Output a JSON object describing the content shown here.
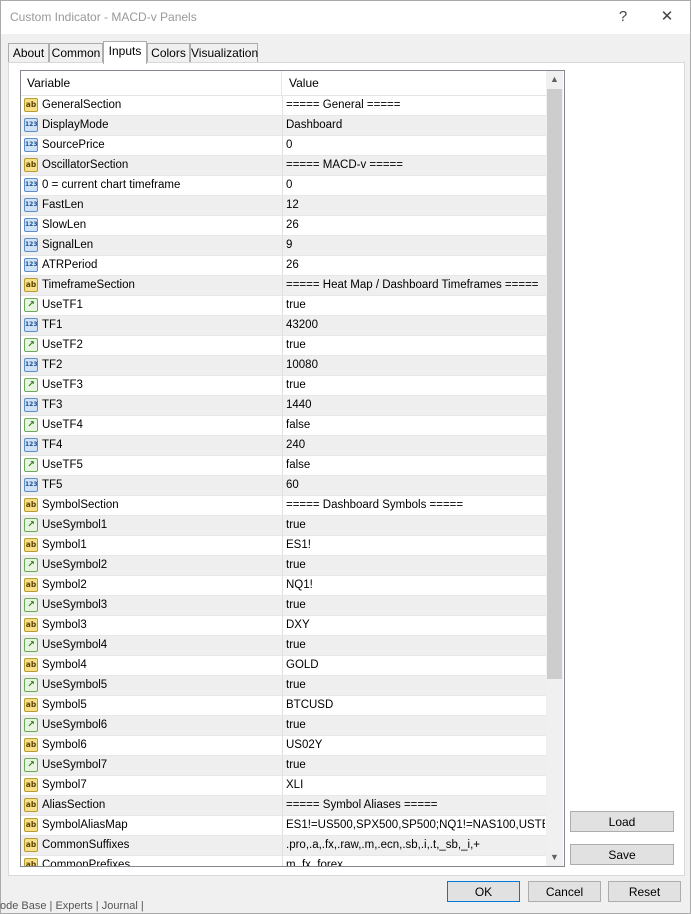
{
  "window": {
    "title": "Custom Indicator - MACD-v Panels",
    "help_glyph": "?",
    "close_glyph": "✕"
  },
  "tabs": [
    {
      "label": "About",
      "active": false
    },
    {
      "label": "Common",
      "active": false
    },
    {
      "label": "Inputs",
      "active": true
    },
    {
      "label": "Colors",
      "active": false
    },
    {
      "label": "Visualization",
      "active": false
    }
  ],
  "table": {
    "headers": {
      "variable": "Variable",
      "value": "Value"
    },
    "rows": [
      {
        "icon": "ab",
        "variable": "GeneralSection",
        "value": "===== General ====="
      },
      {
        "icon": "123",
        "variable": "DisplayMode",
        "value": "Dashboard"
      },
      {
        "icon": "123",
        "variable": "SourcePrice",
        "value": "0"
      },
      {
        "icon": "ab",
        "variable": "OscillatorSection",
        "value": "===== MACD-v ====="
      },
      {
        "icon": "123",
        "variable": "0 = current chart timeframe",
        "value": "0"
      },
      {
        "icon": "123",
        "variable": "FastLen",
        "value": "12"
      },
      {
        "icon": "123",
        "variable": "SlowLen",
        "value": "26"
      },
      {
        "icon": "123",
        "variable": "SignalLen",
        "value": "9"
      },
      {
        "icon": "123",
        "variable": "ATRPeriod",
        "value": "26"
      },
      {
        "icon": "ab",
        "variable": "TimeframeSection",
        "value": "===== Heat Map / Dashboard Timeframes ====="
      },
      {
        "icon": "bool",
        "variable": "UseTF1",
        "value": "true"
      },
      {
        "icon": "123",
        "variable": "TF1",
        "value": "43200"
      },
      {
        "icon": "bool",
        "variable": "UseTF2",
        "value": "true"
      },
      {
        "icon": "123",
        "variable": "TF2",
        "value": "10080"
      },
      {
        "icon": "bool",
        "variable": "UseTF3",
        "value": "true"
      },
      {
        "icon": "123",
        "variable": "TF3",
        "value": "1440"
      },
      {
        "icon": "bool",
        "variable": "UseTF4",
        "value": "false"
      },
      {
        "icon": "123",
        "variable": "TF4",
        "value": "240"
      },
      {
        "icon": "bool",
        "variable": "UseTF5",
        "value": "false"
      },
      {
        "icon": "123",
        "variable": "TF5",
        "value": "60"
      },
      {
        "icon": "ab",
        "variable": "SymbolSection",
        "value": "===== Dashboard Symbols ====="
      },
      {
        "icon": "bool",
        "variable": "UseSymbol1",
        "value": "true"
      },
      {
        "icon": "ab",
        "variable": "Symbol1",
        "value": "ES1!"
      },
      {
        "icon": "bool",
        "variable": "UseSymbol2",
        "value": "true"
      },
      {
        "icon": "ab",
        "variable": "Symbol2",
        "value": "NQ1!"
      },
      {
        "icon": "bool",
        "variable": "UseSymbol3",
        "value": "true"
      },
      {
        "icon": "ab",
        "variable": "Symbol3",
        "value": "DXY"
      },
      {
        "icon": "bool",
        "variable": "UseSymbol4",
        "value": "true"
      },
      {
        "icon": "ab",
        "variable": "Symbol4",
        "value": "GOLD"
      },
      {
        "icon": "bool",
        "variable": "UseSymbol5",
        "value": "true"
      },
      {
        "icon": "ab",
        "variable": "Symbol5",
        "value": "BTCUSD"
      },
      {
        "icon": "bool",
        "variable": "UseSymbol6",
        "value": "true"
      },
      {
        "icon": "ab",
        "variable": "Symbol6",
        "value": "US02Y"
      },
      {
        "icon": "bool",
        "variable": "UseSymbol7",
        "value": "true"
      },
      {
        "icon": "ab",
        "variable": "Symbol7",
        "value": "XLI"
      },
      {
        "icon": "ab",
        "variable": "AliasSection",
        "value": "===== Symbol Aliases ====="
      },
      {
        "icon": "ab",
        "variable": "SymbolAliasMap",
        "value": "ES1!=US500,SPX500,SP500;NQ1!=NAS100,USTE..."
      },
      {
        "icon": "ab",
        "variable": "CommonSuffixes",
        "value": ".pro,.a,.fx,.raw,.m,.ecn,.sb,.i,.t,_sb,_i,+"
      },
      {
        "icon": "ab",
        "variable": "CommonPrefixes",
        "value": "m.,fx.,forex."
      }
    ]
  },
  "side_buttons": {
    "load": "Load",
    "save": "Save"
  },
  "footer_buttons": {
    "ok": "OK",
    "cancel": "Cancel",
    "reset": "Reset"
  },
  "background_strip": "ode Base  |  Experts  |  Journal  |",
  "colors": {
    "accent_selected_tab": "#ffffff",
    "list_border": "#828790",
    "stripe": "#efefef"
  }
}
